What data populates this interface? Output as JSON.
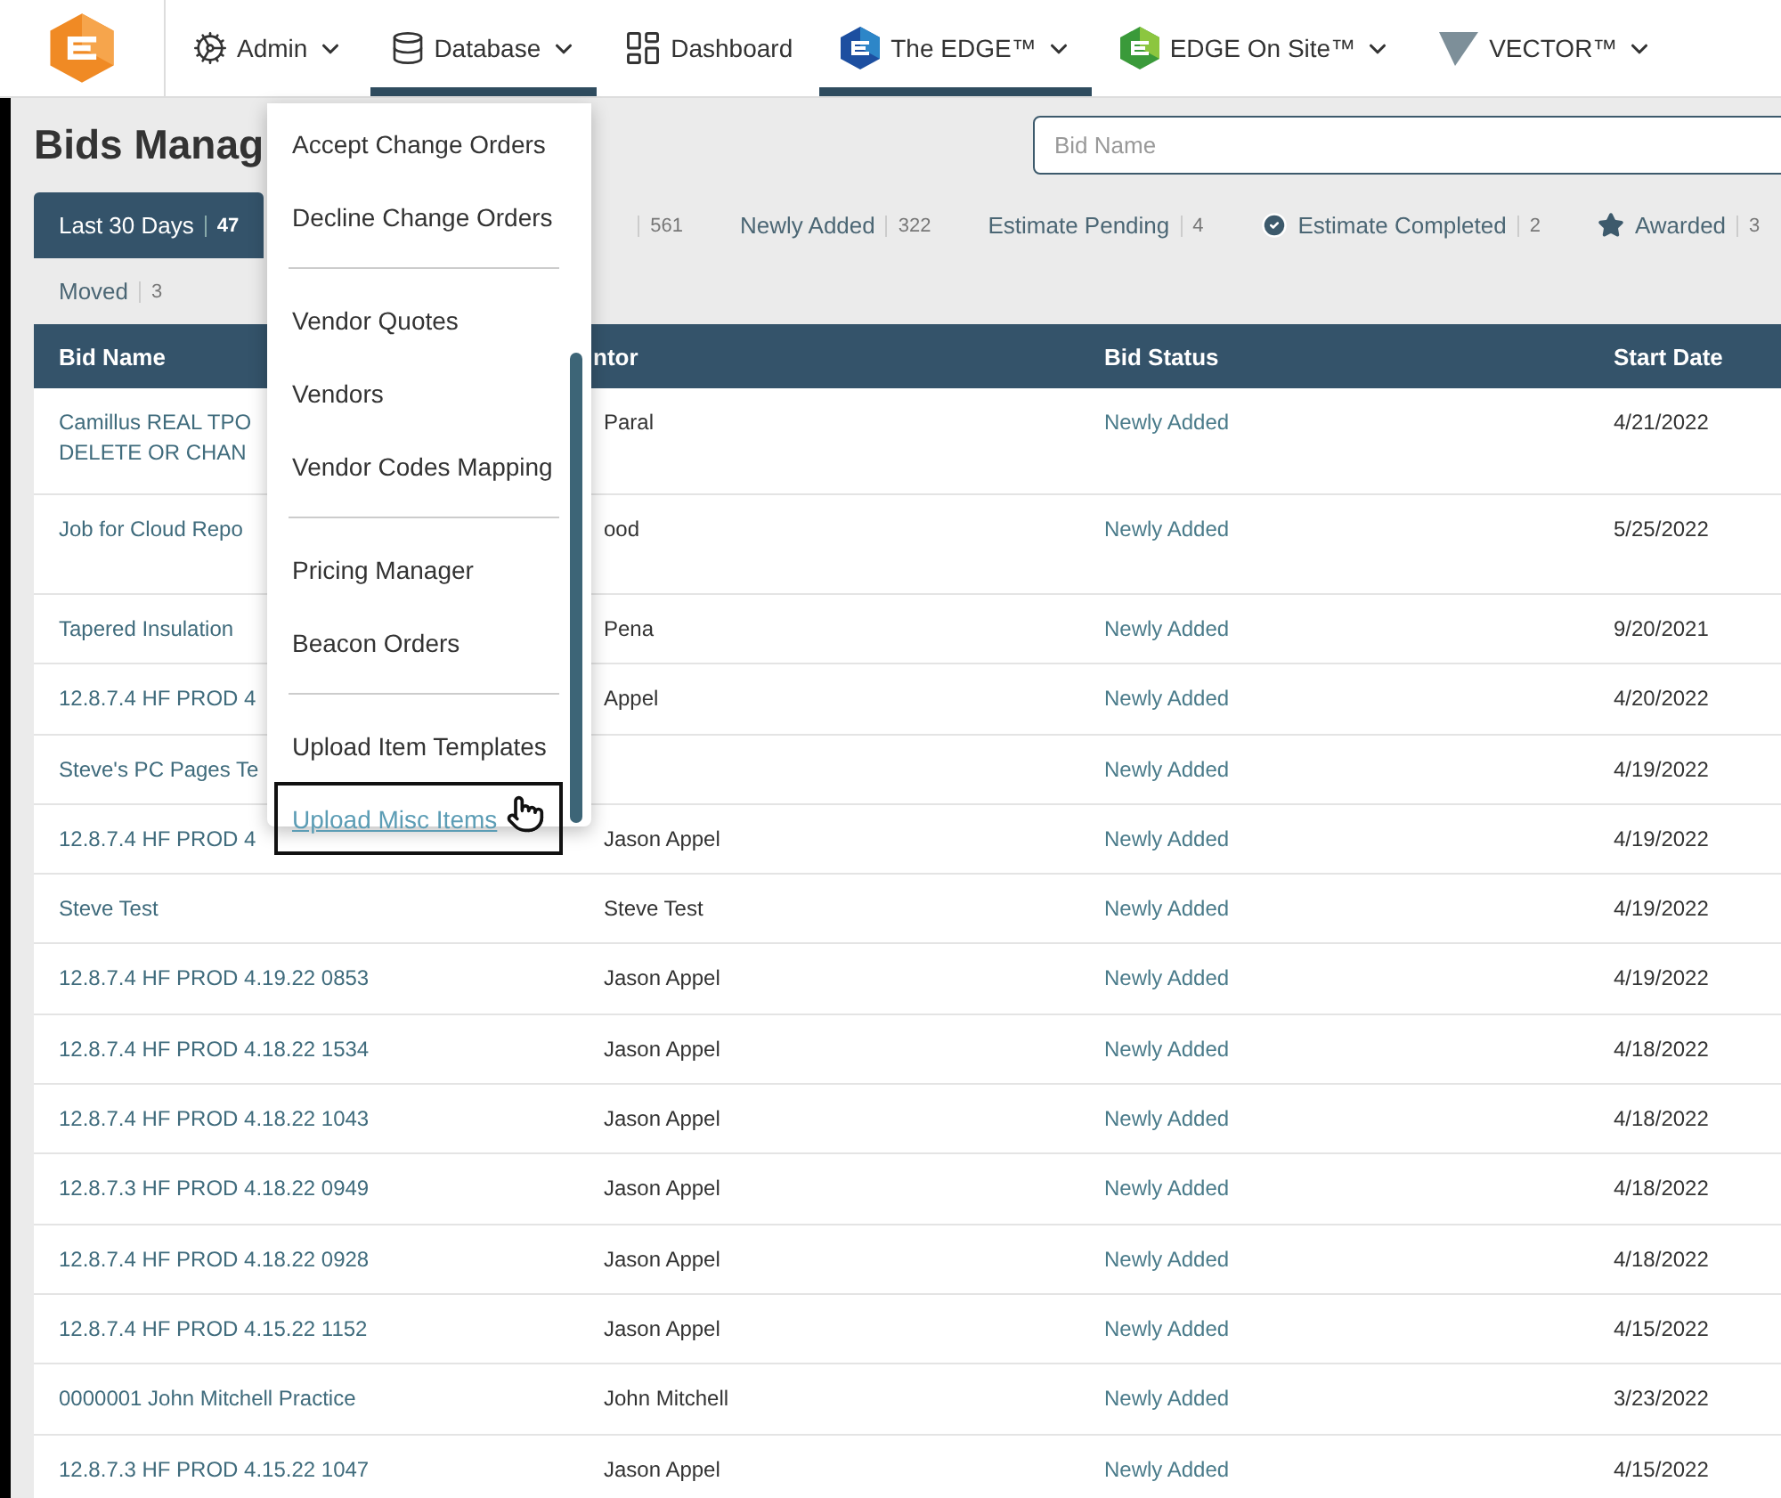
{
  "nav": {
    "items": [
      {
        "kind": "admin",
        "label": "Admin",
        "has_menu": true,
        "selected": false
      },
      {
        "kind": "database",
        "label": "Database",
        "has_menu": true,
        "selected": true
      },
      {
        "kind": "dashboard",
        "label": "Dashboard",
        "has_menu": false,
        "selected": false
      },
      {
        "kind": "edge",
        "label": "The EDGE™",
        "has_menu": true,
        "selected": true
      },
      {
        "kind": "onsite",
        "label": "EDGE On Site™",
        "has_menu": true,
        "selected": false
      },
      {
        "kind": "vector",
        "label": "VECTOR™",
        "has_menu": true,
        "selected": false
      }
    ]
  },
  "page": {
    "title": "Bids Manag",
    "search": {
      "placeholder": "Bid Name"
    }
  },
  "filters": [
    {
      "kind": "plain",
      "label": "Last 30 Days",
      "count": "47",
      "selected": true
    },
    {
      "kind": "covered",
      "count": "561",
      "selected": false
    },
    {
      "kind": "plain",
      "label": "Newly Added",
      "count": "322",
      "selected": false
    },
    {
      "kind": "plain",
      "label": "Estimate Pending",
      "count": "4",
      "selected": false
    },
    {
      "kind": "completed",
      "label": "Estimate Completed",
      "count": "2",
      "selected": false
    },
    {
      "kind": "awarded",
      "label": "Awarded",
      "count": "3",
      "selected": false
    },
    {
      "kind": "plain",
      "label": "Moved",
      "count": "3",
      "selected": false
    }
  ],
  "table": {
    "columns": [
      "Bid Name",
      "ntor",
      "Bid Status",
      "Start Date"
    ],
    "rows": [
      {
        "bid_name": [
          "Camillus REAL TPO",
          "DELETE OR CHAN"
        ],
        "estimator": "Paral",
        "bid_status": "Newly Added",
        "start_date": "4/21/2022"
      },
      {
        "bid_name": [
          "Job for Cloud Repo"
        ],
        "estimator": "ood",
        "bid_status": "Newly Added",
        "start_date": "5/25/2022"
      },
      {
        "bid_name": [
          "Tapered Insulation"
        ],
        "estimator": "Pena",
        "bid_status": "Newly Added",
        "start_date": "9/20/2021"
      },
      {
        "bid_name": [
          "12.8.7.4 HF PROD 4"
        ],
        "estimator": "Appel",
        "bid_status": "Newly Added",
        "start_date": "4/20/2022"
      },
      {
        "bid_name": [
          "Steve's PC Pages Te"
        ],
        "bid_status": "Newly Added",
        "start_date": "4/19/2022"
      },
      {
        "bid_name": [
          "12.8.7.4 HF PROD 4"
        ],
        "estimator": "Jason Appel",
        "bid_status": "Newly Added",
        "start_date": "4/19/2022"
      },
      {
        "bid_name": [
          "Steve Test"
        ],
        "estimator": "Steve Test",
        "bid_status": "Newly Added",
        "start_date": "4/19/2022"
      },
      {
        "bid_name": [
          "12.8.7.4 HF PROD 4.19.22 0853"
        ],
        "estimator": "Jason Appel",
        "bid_status": "Newly Added",
        "start_date": "4/19/2022"
      },
      {
        "bid_name": [
          "12.8.7.4 HF PROD 4.18.22 1534"
        ],
        "estimator": "Jason Appel",
        "bid_status": "Newly Added",
        "start_date": "4/18/2022"
      },
      {
        "bid_name": [
          "12.8.7.4 HF PROD 4.18.22 1043"
        ],
        "estimator": "Jason Appel",
        "bid_status": "Newly Added",
        "start_date": "4/18/2022"
      },
      {
        "bid_name": [
          "12.8.7.3 HF PROD 4.18.22 0949"
        ],
        "estimator": "Jason Appel",
        "bid_status": "Newly Added",
        "start_date": "4/18/2022"
      },
      {
        "bid_name": [
          "12.8.7.4 HF PROD 4.18.22 0928"
        ],
        "estimator": "Jason Appel",
        "bid_status": "Newly Added",
        "start_date": "4/18/2022"
      },
      {
        "bid_name": [
          "12.8.7.4 HF PROD 4.15.22 1152"
        ],
        "estimator": "Jason Appel",
        "bid_status": "Newly Added",
        "start_date": "4/15/2022"
      },
      {
        "bid_name": [
          "0000001 John Mitchell Practice"
        ],
        "estimator": "John Mitchell",
        "bid_status": "Newly Added",
        "start_date": "3/23/2022"
      },
      {
        "bid_name": [
          "12.8.7.3 HF PROD 4.15.22 1047"
        ],
        "estimator": "Jason Appel",
        "bid_status": "Newly Added",
        "start_date": "4/15/2022"
      }
    ]
  },
  "dropdown": {
    "groups": [
      [
        {
          "label": "Accept Change Orders",
          "hovered": false
        },
        {
          "label": "Decline Change Orders",
          "hovered": false
        }
      ],
      [
        {
          "label": "Vendor Quotes",
          "hovered": false
        },
        {
          "label": "Vendors",
          "hovered": false
        },
        {
          "label": "Vendor Codes Mapping",
          "hovered": false
        }
      ],
      [
        {
          "label": "Pricing Manager",
          "hovered": false
        },
        {
          "label": "Beacon Orders",
          "hovered": false
        }
      ],
      [
        {
          "label": "Upload Item Templates",
          "hovered": false
        },
        {
          "label": "Upload Misc Items",
          "hovered": true
        }
      ]
    ]
  }
}
